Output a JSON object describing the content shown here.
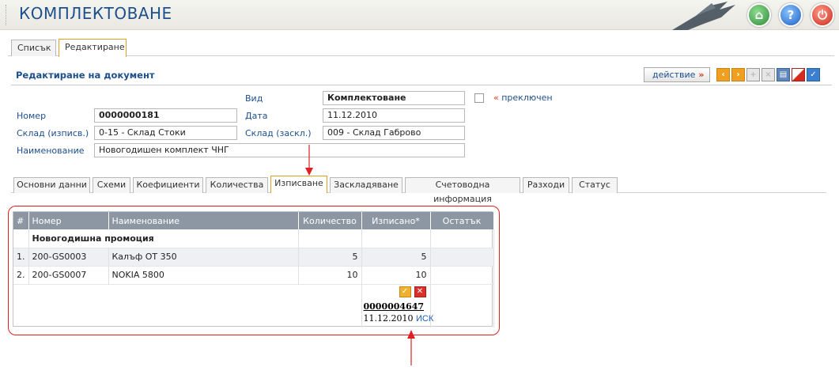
{
  "header": {
    "title": "КОМПЛЕКТОВАНЕ"
  },
  "top_tabs": [
    {
      "label": "Списък",
      "active": false
    },
    {
      "label": "Редактиране",
      "active": true
    }
  ],
  "section": {
    "title": "Редактиране на документ",
    "action_label": "действие",
    "action_arrow": "»"
  },
  "toolbar_icons": [
    "arrow-left-icon",
    "arrow-right-icon",
    "add-icon",
    "delete-icon",
    "print-icon",
    "flag-icon",
    "confirm-icon"
  ],
  "form": {
    "type_label": "Вид",
    "type_value": "Комплектоване",
    "switch_link": "преключен",
    "switch_quote": "«",
    "number_label": "Номер",
    "number_value": "0000000181",
    "date_label": "Дата",
    "date_value": "11.12.2010",
    "store_out_label": "Склад (изписв.)",
    "store_out_value": "0-15 - Склад Стоки",
    "store_in_label": "Склад (заскл.)",
    "store_in_value": "009 - Склад Габрово",
    "name_label": "Наименование",
    "name_value": "Новогодишен комплект ЧНГ"
  },
  "sub_tabs": [
    {
      "label": "Основни данни",
      "active": false
    },
    {
      "label": "Схеми",
      "active": false
    },
    {
      "label": "Коефициенти",
      "active": false
    },
    {
      "label": "Количества",
      "active": false
    },
    {
      "label": "Изписване",
      "active": true
    },
    {
      "label": "Заскладяване",
      "active": false
    },
    {
      "label": "Счетоводна информация",
      "active": false
    },
    {
      "label": "Разходи",
      "active": false
    },
    {
      "label": "Статус",
      "active": false
    }
  ],
  "table": {
    "columns": [
      "#",
      "Номер",
      "Наименование",
      "Количество",
      "Изписано*",
      "Остатък"
    ],
    "group_title": "Новогодишна промоция",
    "rows": [
      {
        "idx": "1.",
        "code": "200-GS0003",
        "name": "Калъф ОТ 350",
        "qty": "5",
        "issued": "5",
        "rest": ""
      },
      {
        "idx": "2.",
        "code": "200-GS0007",
        "name": "NOKIA 5800",
        "qty": "10",
        "issued": "10",
        "rest": ""
      }
    ],
    "doc": {
      "number": "0000004647",
      "date": "11.12.2010",
      "link": "ИСК"
    }
  },
  "colors": {
    "accent": "#1d4f8c",
    "highlight": "#e02020",
    "active_tab_border": "#e0a020"
  }
}
